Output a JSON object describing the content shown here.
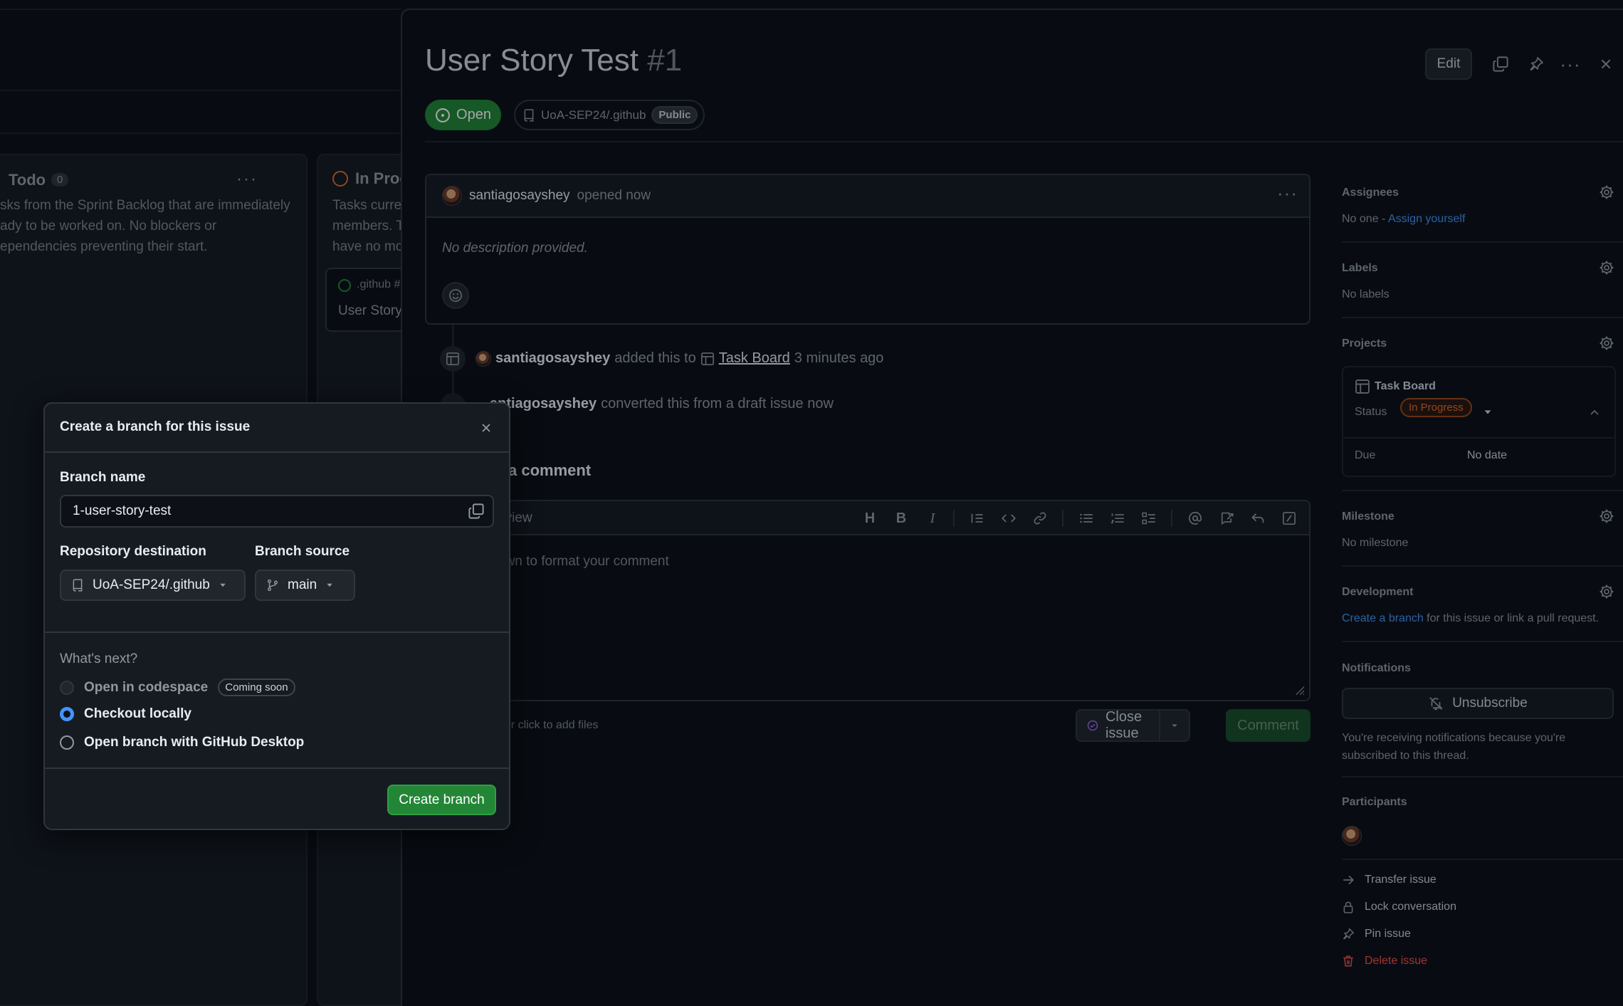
{
  "board": {
    "todo": {
      "title": "Todo",
      "count": "0",
      "description_lines": [
        "sks from the Sprint Backlog that are immediately",
        "ady to be worked on. No blockers or",
        "ependencies preventing their start."
      ]
    },
    "in_progress": {
      "title": "In Prog",
      "description_lines": [
        "Tasks curren",
        "members. T",
        "have no mo"
      ],
      "card_repo": ".github #",
      "card_title": "User Story"
    }
  },
  "issue": {
    "title": "User Story Test",
    "number": "#1",
    "edit_label": "Edit",
    "state": "Open",
    "repo": "UoA-SEP24/.github",
    "visibility": "Public"
  },
  "comment": {
    "author": "santiagosayshey",
    "action": "opened now",
    "body": "No description provided."
  },
  "timeline": [
    {
      "user": "santiagosayshey",
      "text_before": "added this to",
      "link": "Task Board",
      "text_after": "3 minutes ago"
    },
    {
      "user": "antiagosayshey",
      "text": "converted this from a draft issue now"
    }
  ],
  "editor": {
    "title": "a comment",
    "preview_tab": "eview",
    "placeholder": "own to format your comment",
    "attach_hint": ", or click to add files",
    "close_issue": "Close issue",
    "comment_button": "Comment"
  },
  "sidebar": {
    "assignees": {
      "label": "Assignees",
      "value": "No one - ",
      "link": "Assign yourself"
    },
    "labels": {
      "label": "Labels",
      "value": "No labels"
    },
    "projects": {
      "label": "Projects",
      "project": "Task Board",
      "status_label": "Status",
      "status": "In Progress",
      "due_label": "Due",
      "due": "No date",
      "status_color": "#db6d28"
    },
    "milestone": {
      "label": "Milestone",
      "value": "No milestone"
    },
    "development": {
      "label": "Development",
      "link": "Create a branch",
      "value": " for this issue or link a pull request."
    },
    "notifications": {
      "label": "Notifications",
      "button": "Unsubscribe",
      "note_lines": [
        "You're receiving notifications because you're",
        "subscribed to this thread."
      ]
    },
    "participants": {
      "label": "Participants"
    },
    "actions": [
      "Transfer issue",
      "Lock conversation",
      "Pin issue",
      "Delete issue"
    ]
  },
  "dialog": {
    "title": "Create a branch for this issue",
    "branch_name_label": "Branch name",
    "branch_name": "1-user-story-test",
    "repo_dest_label": "Repository destination",
    "repo_dest": "UoA-SEP24/.github",
    "branch_source_label": "Branch source",
    "branch_source": "main",
    "whats_next": "What's next?",
    "options": [
      {
        "label": "Open in codespace",
        "badge": "Coming soon",
        "state": "disabled"
      },
      {
        "label": "Checkout locally",
        "state": "checked"
      },
      {
        "label": "Open branch with GitHub Desktop",
        "state": "unchecked"
      }
    ],
    "create_button": "Create branch"
  },
  "colors": {
    "open_green": "#238636",
    "link_blue": "#4493f8",
    "danger": "#f85149"
  }
}
